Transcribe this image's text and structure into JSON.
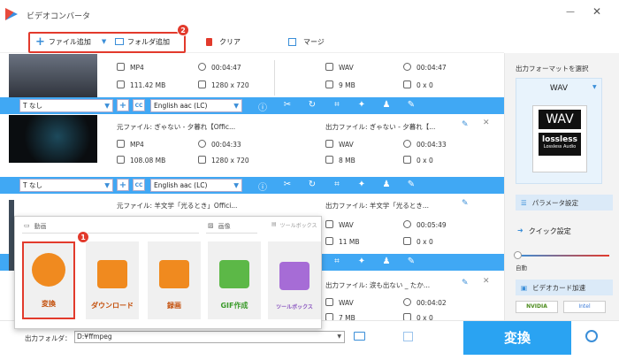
{
  "app": {
    "title": "ビデオコンバータ"
  },
  "toolbar": {
    "add_file": "ファイル追加",
    "add_folder": "フォルダ追加",
    "clear": "クリア",
    "merge": "マージ",
    "badge2": "2"
  },
  "files": [
    {
      "src_format": "MP4",
      "src_duration": "00:04:47",
      "src_size": "111.42 MB",
      "src_res": "1280 x 720",
      "out_format": "WAV",
      "out_duration": "00:04:47",
      "out_size": "9 MB",
      "out_res": "0 x 0"
    },
    {
      "src_name": "元ファイル: ぎゃない - 夕暮れ【Offic...",
      "out_name": "出力ファイル: ぎゃない - 夕暮れ【...",
      "src_format": "MP4",
      "src_duration": "00:04:33",
      "src_size": "108.08 MB",
      "src_res": "1280 x 720",
      "out_format": "WAV",
      "out_duration": "00:04:33",
      "out_size": "8 MB",
      "out_res": "0 x 0"
    },
    {
      "src_name": "元ファイル: 羊文学「光るとき」Offici...",
      "out_name": "出力ファイル: 羊文学「光るとき...",
      "out_format": "WAV",
      "out_duration": "00:05:49",
      "out_size": "11 MB",
      "out_res": "0 x 0"
    },
    {
      "out_name": "出力ファイル: 涙も出ない _ たか...",
      "out_format": "WAV",
      "out_duration": "00:04:02",
      "out_size": "7 MB",
      "out_res": "0 x 0"
    }
  ],
  "track": {
    "subtitle": "なし",
    "audio": "English aac (LC)",
    "cc": "CC"
  },
  "side": {
    "label": "出力フォーマットを選択",
    "format": "WAV",
    "format_big": "WAV",
    "lossless": "lossless",
    "lossless_sub": "Lossless Audio",
    "param": "パラメータ設定",
    "quick": "クイック設定",
    "auto": "自動",
    "gpu": "ビデオカード加速",
    "nvidia": "NVIDIA",
    "intel": "Intel"
  },
  "popup": {
    "video": "動画",
    "image": "画像",
    "toolbox_h": "ツールボックス",
    "convert": "変換",
    "download": "ダウンロード",
    "record": "録画",
    "gif": "GIF作成",
    "toolbox": "ツールボックス",
    "badge1": "1"
  },
  "bottom": {
    "folder_label": "出力フォルダ：",
    "folder_path": "D:¥ffmpeg",
    "convert": "変換"
  }
}
